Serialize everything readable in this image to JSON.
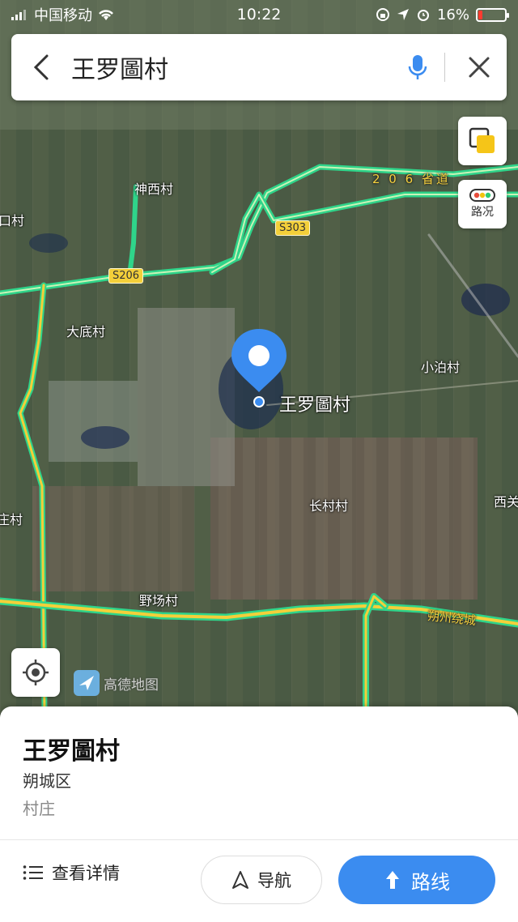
{
  "status_bar": {
    "carrier": "中国移动",
    "time": "10:22",
    "battery_percent": "16%",
    "battery_level": 0.16
  },
  "search": {
    "query": "王罗圖村"
  },
  "map": {
    "traffic_label": "路况",
    "logo_text": "高德地图",
    "pin_label": "王罗圖村",
    "place_labels": [
      "神西村",
      "口村",
      "大底村",
      "小泊村",
      "长村村",
      "西关",
      "庄村",
      "野场村"
    ],
    "road_shields": [
      "S303",
      "S206"
    ],
    "road_names": [
      "2 0 6 省道",
      "朔州绕城"
    ]
  },
  "sheet": {
    "title": "王罗圖村",
    "district": "朔城区",
    "category": "村庄",
    "details_label": "查看详情",
    "nav_label": "导航",
    "route_label": "路线"
  },
  "colors": {
    "accent": "#3b8cf0",
    "road_green": "#2fd48a",
    "road_yellow": "#f3cf3a"
  }
}
